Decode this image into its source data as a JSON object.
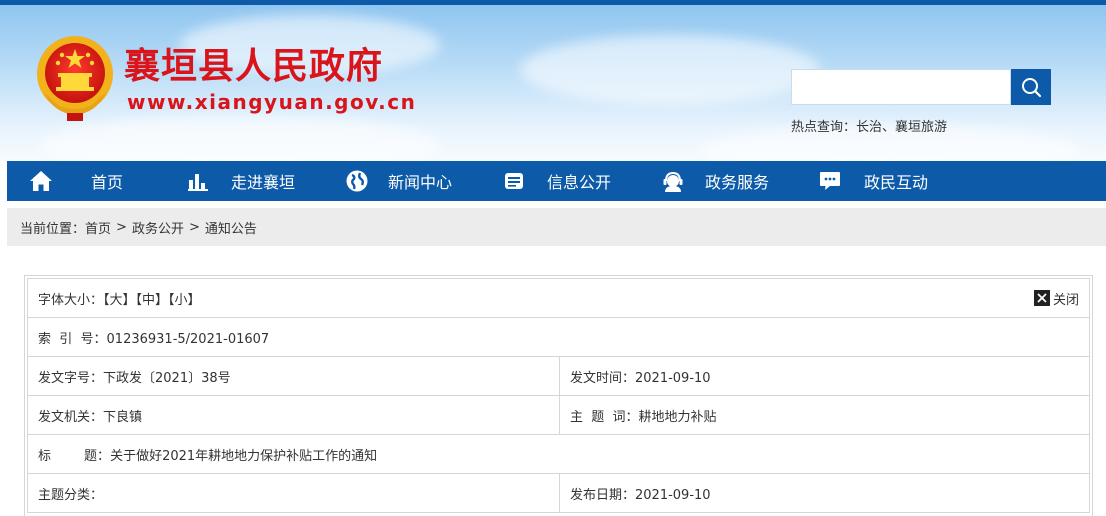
{
  "header": {
    "site_name": "襄垣县人民政府",
    "site_url": "www.xiangyuan.gov.cn",
    "search_placeholder": "",
    "hot_label": "热点查询：",
    "hot_links": [
      "长治",
      "襄垣旅游"
    ],
    "hot_sep": "、"
  },
  "nav": {
    "items": [
      {
        "label": "首页",
        "icon": "home-icon"
      },
      {
        "label": "走进襄垣",
        "icon": "chart-icon"
      },
      {
        "label": "新闻中心",
        "icon": "globe-icon"
      },
      {
        "label": "信息公开",
        "icon": "document-icon"
      },
      {
        "label": "政务服务",
        "icon": "service-person-icon"
      },
      {
        "label": "政民互动",
        "icon": "chat-icon"
      }
    ]
  },
  "breadcrumb": {
    "prefix": "当前位置：",
    "items": [
      "首页",
      "政务公开",
      "通知公告"
    ],
    "sep": ">"
  },
  "info": {
    "font_size_label": "字体大小：",
    "font_large": "【大】",
    "font_medium": "【中】",
    "font_small": "【小】",
    "close_label": "关闭",
    "index_label": "索  引  号：",
    "index_value": "01236931-5/2021-01607",
    "doc_no_label": "发文字号：",
    "doc_no_value": "下政发〔2021〕38号",
    "issue_time_label": "发文时间：",
    "issue_time_value": "2021-09-10",
    "issuer_label": "发文机关：",
    "issuer_value": "下良镇",
    "keyword_label": "主  题  词：",
    "keyword_value": "耕地地力补贴",
    "title_label": "标        题：",
    "title_value": "关于做好2021年耕地地力保护补贴工作的通知",
    "category_label": "主题分类：",
    "category_value": "",
    "publish_date_label": "发布日期：",
    "publish_date_value": "2021-09-10"
  },
  "colors": {
    "brand_blue": "#0d5ba8",
    "brand_red": "#d9141b"
  }
}
